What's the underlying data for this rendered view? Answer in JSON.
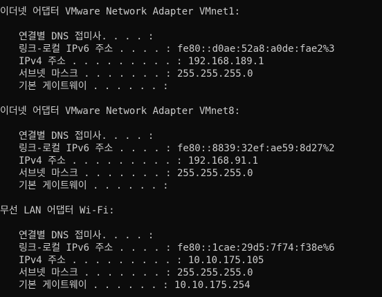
{
  "console": {
    "adapters": [
      {
        "header": "이더넷 어댑터 VMware Network Adapter VMnet1:",
        "fields": [
          {
            "label": "연결별 DNS 접미사. . . . :",
            "value": ""
          },
          {
            "label": "링크-로컬 IPv6 주소 . . . . :",
            "value": " fe80::d0ae:52a8:a0de:fae2%3"
          },
          {
            "label": "IPv4 주소 . . . . . . . . . :",
            "value": " 192.168.189.1"
          },
          {
            "label": "서브넷 마스크 . . . . . . . :",
            "value": " 255.255.255.0"
          },
          {
            "label": "기본 게이트웨이 . . . . . . :",
            "value": ""
          }
        ]
      },
      {
        "header": "이더넷 어댑터 VMware Network Adapter VMnet8:",
        "fields": [
          {
            "label": "연결별 DNS 접미사. . . . :",
            "value": ""
          },
          {
            "label": "링크-로컬 IPv6 주소 . . . . :",
            "value": " fe80::8839:32ef:ae59:8d27%2"
          },
          {
            "label": "IPv4 주소 . . . . . . . . . :",
            "value": " 192.168.91.1"
          },
          {
            "label": "서브넷 마스크 . . . . . . . :",
            "value": " 255.255.255.0"
          },
          {
            "label": "기본 게이트웨이 . . . . . . :",
            "value": ""
          }
        ]
      },
      {
        "header": "무선 LAN 어댑터 Wi-Fi:",
        "fields": [
          {
            "label": "연결별 DNS 접미사. . . . :",
            "value": ""
          },
          {
            "label": "링크-로컬 IPv6 주소 . . . . :",
            "value": " fe80::1cae:29d5:7f74:f38e%6"
          },
          {
            "label": "IPv4 주소 . . . . . . . . . :",
            "value": " 10.10.175.105"
          },
          {
            "label": "서브넷 마스크 . . . . . . . :",
            "value": " 255.255.255.0"
          },
          {
            "label": "기본 게이트웨이 . . . . . . :",
            "value": " 10.10.175.254"
          }
        ]
      }
    ],
    "colors": {
      "background": "#0c0c0c",
      "text": "#cccccc"
    }
  }
}
